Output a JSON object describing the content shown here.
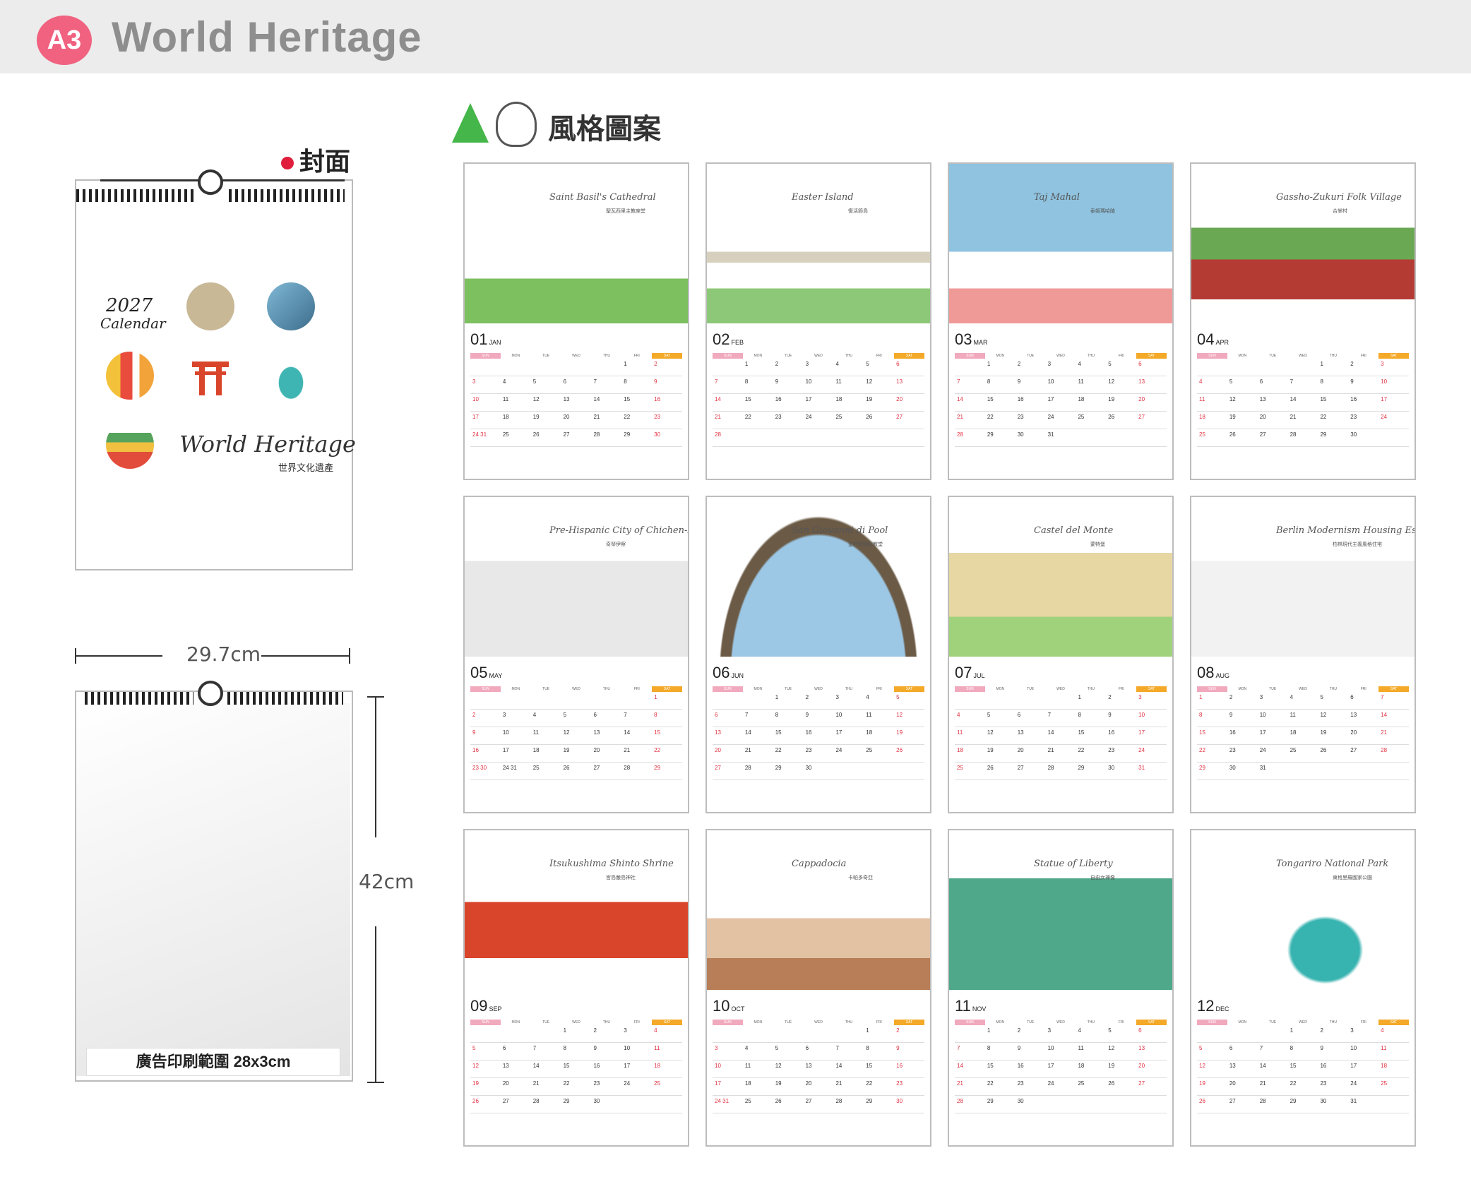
{
  "header": {
    "badge": "A3",
    "title": "World Heritage"
  },
  "style_label": "風格圖案",
  "cover_label": "封面",
  "cover": {
    "year": "2027",
    "calendar": "Calendar",
    "title": "World Heritage",
    "subtitle": "世界文化遺產"
  },
  "dimensions": {
    "width": "29.7cm",
    "height": "42cm",
    "ad_area": "廣告印刷範圍 28x3cm"
  },
  "weekdays": [
    "SUN",
    "MON",
    "TUE",
    "WED",
    "THU",
    "FRI",
    "SAT"
  ],
  "months": [
    {
      "num": "01",
      "abbr": "JAN",
      "name": "Saint Basil's Cathedral",
      "cn": "聖瓦西里主教座堂",
      "weeks": [
        [
          "",
          "",
          "",
          "",
          "",
          "1",
          "2"
        ],
        [
          "3",
          "4",
          "5",
          "6",
          "7",
          "8",
          "9"
        ],
        [
          "10",
          "11",
          "12",
          "13",
          "14",
          "15",
          "16"
        ],
        [
          "17",
          "18",
          "19",
          "20",
          "21",
          "22",
          "23"
        ],
        [
          "24 31",
          "25",
          "26",
          "27",
          "28",
          "29",
          "30"
        ]
      ]
    },
    {
      "num": "02",
      "abbr": "FEB",
      "name": "Easter Island",
      "cn": "復活節島",
      "weeks": [
        [
          "",
          "1",
          "2",
          "3",
          "4",
          "5",
          "6"
        ],
        [
          "7",
          "8",
          "9",
          "10",
          "11",
          "12",
          "13"
        ],
        [
          "14",
          "15",
          "16",
          "17",
          "18",
          "19",
          "20"
        ],
        [
          "21",
          "22",
          "23",
          "24",
          "25",
          "26",
          "27"
        ],
        [
          "28",
          "",
          "",
          "",
          "",
          "",
          ""
        ]
      ]
    },
    {
      "num": "03",
      "abbr": "MAR",
      "name": "Taj Mahal",
      "cn": "泰姬瑪哈陵",
      "weeks": [
        [
          "",
          "1",
          "2",
          "3",
          "4",
          "5",
          "6"
        ],
        [
          "7",
          "8",
          "9",
          "10",
          "11",
          "12",
          "13"
        ],
        [
          "14",
          "15",
          "16",
          "17",
          "18",
          "19",
          "20"
        ],
        [
          "21",
          "22",
          "23",
          "24",
          "25",
          "26",
          "27"
        ],
        [
          "28",
          "29",
          "30",
          "31",
          "",
          "",
          ""
        ]
      ]
    },
    {
      "num": "04",
      "abbr": "APR",
      "name": "Gassho-Zukuri Folk Village",
      "cn": "合掌村",
      "weeks": [
        [
          "",
          "",
          "",
          "",
          "1",
          "2",
          "3"
        ],
        [
          "4",
          "5",
          "6",
          "7",
          "8",
          "9",
          "10"
        ],
        [
          "11",
          "12",
          "13",
          "14",
          "15",
          "16",
          "17"
        ],
        [
          "18",
          "19",
          "20",
          "21",
          "22",
          "23",
          "24"
        ],
        [
          "25",
          "26",
          "27",
          "28",
          "29",
          "30",
          ""
        ]
      ]
    },
    {
      "num": "05",
      "abbr": "MAY",
      "name": "Pre-Hispanic City of Chichen-Itza",
      "cn": "奇琴伊察",
      "weeks": [
        [
          "",
          "",
          "",
          "",
          "",
          "",
          "1"
        ],
        [
          "2",
          "3",
          "4",
          "5",
          "6",
          "7",
          "8"
        ],
        [
          "9",
          "10",
          "11",
          "12",
          "13",
          "14",
          "15"
        ],
        [
          "16",
          "17",
          "18",
          "19",
          "20",
          "21",
          "22"
        ],
        [
          "23 30",
          "24 31",
          "25",
          "26",
          "27",
          "28",
          "29"
        ]
      ]
    },
    {
      "num": "06",
      "abbr": "JUN",
      "name": "San Giovanni di Pool",
      "cn": "聖若望朝聖教堂",
      "weeks": [
        [
          "",
          "",
          "1",
          "2",
          "3",
          "4",
          "5"
        ],
        [
          "6",
          "7",
          "8",
          "9",
          "10",
          "11",
          "12"
        ],
        [
          "13",
          "14",
          "15",
          "16",
          "17",
          "18",
          "19"
        ],
        [
          "20",
          "21",
          "22",
          "23",
          "24",
          "25",
          "26"
        ],
        [
          "27",
          "28",
          "29",
          "30",
          "",
          "",
          ""
        ]
      ]
    },
    {
      "num": "07",
      "abbr": "JUL",
      "name": "Castel del Monte",
      "cn": "蒙特堡",
      "weeks": [
        [
          "",
          "",
          "",
          "",
          "1",
          "2",
          "3"
        ],
        [
          "4",
          "5",
          "6",
          "7",
          "8",
          "9",
          "10"
        ],
        [
          "11",
          "12",
          "13",
          "14",
          "15",
          "16",
          "17"
        ],
        [
          "18",
          "19",
          "20",
          "21",
          "22",
          "23",
          "24"
        ],
        [
          "25",
          "26",
          "27",
          "28",
          "29",
          "30",
          "31"
        ]
      ]
    },
    {
      "num": "08",
      "abbr": "AUG",
      "name": "Berlin Modernism Housing Estates",
      "cn": "柏林現代主義風格住宅",
      "weeks": [
        [
          "1",
          "2",
          "3",
          "4",
          "5",
          "6",
          "7"
        ],
        [
          "8",
          "9",
          "10",
          "11",
          "12",
          "13",
          "14"
        ],
        [
          "15",
          "16",
          "17",
          "18",
          "19",
          "20",
          "21"
        ],
        [
          "22",
          "23",
          "24",
          "25",
          "26",
          "27",
          "28"
        ],
        [
          "29",
          "30",
          "31",
          "",
          "",
          "",
          ""
        ]
      ]
    },
    {
      "num": "09",
      "abbr": "SEP",
      "name": "Itsukushima Shinto Shrine",
      "cn": "宮島嚴島神社",
      "weeks": [
        [
          "",
          "",
          "",
          "1",
          "2",
          "3",
          "4"
        ],
        [
          "5",
          "6",
          "7",
          "8",
          "9",
          "10",
          "11"
        ],
        [
          "12",
          "13",
          "14",
          "15",
          "16",
          "17",
          "18"
        ],
        [
          "19",
          "20",
          "21",
          "22",
          "23",
          "24",
          "25"
        ],
        [
          "26",
          "27",
          "28",
          "29",
          "30",
          "",
          ""
        ]
      ]
    },
    {
      "num": "10",
      "abbr": "OCT",
      "name": "Cappadocia",
      "cn": "卡帕多奇亞",
      "weeks": [
        [
          "",
          "",
          "",
          "",
          "",
          "1",
          "2"
        ],
        [
          "3",
          "4",
          "5",
          "6",
          "7",
          "8",
          "9"
        ],
        [
          "10",
          "11",
          "12",
          "13",
          "14",
          "15",
          "16"
        ],
        [
          "17",
          "18",
          "19",
          "20",
          "21",
          "22",
          "23"
        ],
        [
          "24 31",
          "25",
          "26",
          "27",
          "28",
          "29",
          "30"
        ]
      ]
    },
    {
      "num": "11",
      "abbr": "NOV",
      "name": "Statue of Liberty",
      "cn": "自由女神像",
      "weeks": [
        [
          "",
          "1",
          "2",
          "3",
          "4",
          "5",
          "6"
        ],
        [
          "7",
          "8",
          "9",
          "10",
          "11",
          "12",
          "13"
        ],
        [
          "14",
          "15",
          "16",
          "17",
          "18",
          "19",
          "20"
        ],
        [
          "21",
          "22",
          "23",
          "24",
          "25",
          "26",
          "27"
        ],
        [
          "28",
          "29",
          "30",
          "",
          "",
          "",
          ""
        ]
      ]
    },
    {
      "num": "12",
      "abbr": "DEC",
      "name": "Tongariro National Park",
      "cn": "東格里羅國家公園",
      "weeks": [
        [
          "",
          "",
          "",
          "1",
          "2",
          "3",
          "4"
        ],
        [
          "5",
          "6",
          "7",
          "8",
          "9",
          "10",
          "11"
        ],
        [
          "12",
          "13",
          "14",
          "15",
          "16",
          "17",
          "18"
        ],
        [
          "19",
          "20",
          "21",
          "22",
          "23",
          "24",
          "25"
        ],
        [
          "26",
          "27",
          "28",
          "29",
          "30",
          "31",
          ""
        ]
      ]
    }
  ]
}
